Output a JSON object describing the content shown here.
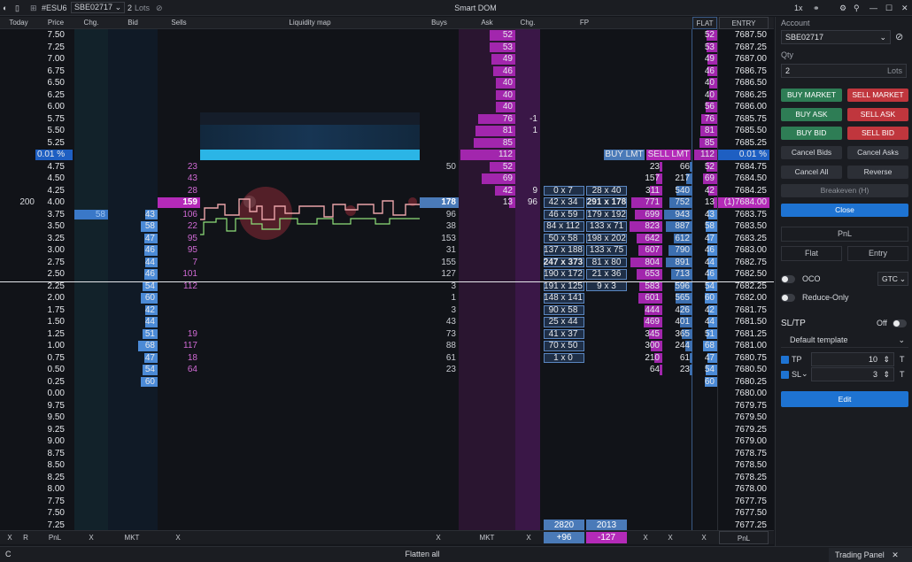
{
  "titlebar": {
    "symbol": "#ESU6",
    "account": "SBE02717",
    "lots_count": "2",
    "lots_unit": "Lots",
    "title": "Smart DOM",
    "zoom": "1x"
  },
  "headers": {
    "today": "Today",
    "price": "Price",
    "chg": "Chg.",
    "bid": "Bid",
    "sells": "Sells",
    "liq": "Liquidity map",
    "buys": "Buys",
    "ask": "Ask",
    "chg2": "Chg.",
    "fp": "FP",
    "flat": "FLAT",
    "entry": "ENTRY"
  },
  "rows": [
    {
      "price": "7.50",
      "ask": "52",
      "flat": "52",
      "entry": "7687.50"
    },
    {
      "price": "7.25",
      "ask": "53",
      "flat": "53",
      "entry": "7687.25"
    },
    {
      "price": "7.00",
      "ask": "49",
      "flat": "49",
      "entry": "7687.00"
    },
    {
      "price": "6.75",
      "ask": "46",
      "flat": "46",
      "entry": "7686.75"
    },
    {
      "price": "6.50",
      "ask": "40",
      "flat": "40",
      "entry": "7686.50"
    },
    {
      "price": "6.25",
      "ask": "40",
      "flat": "40",
      "entry": "7686.25"
    },
    {
      "price": "6.00",
      "ask": "40",
      "flat": "56",
      "entry": "7686.00"
    },
    {
      "price": "5.75",
      "ask": "76",
      "chg2": "-1",
      "flat": "76",
      "entry": "7685.75"
    },
    {
      "price": "5.50",
      "ask": "81",
      "chg2": "1",
      "flat": "81",
      "entry": "7685.50"
    },
    {
      "price": "5.25",
      "ask": "85",
      "flat": "85",
      "entry": "7685.25"
    },
    {
      "price": "0.01 %",
      "ask": "112",
      "fpl": "BUY LMT",
      "fpr": "SELL LMT",
      "flat": "112",
      "entry": "0.01 %"
    },
    {
      "price": "4.75",
      "sells": "23",
      "buys": "50",
      "ask": "52",
      "v1": "23",
      "v2": "66",
      "flat": "52",
      "entry": "7684.75"
    },
    {
      "price": "4.50",
      "sells": "43",
      "ask": "69",
      "v1": "157",
      "v2": "217",
      "flat": "69",
      "entry": "7684.50"
    },
    {
      "price": "4.25",
      "sells": "28",
      "ask": "42",
      "chg2": "9",
      "fpl": "0 x 7",
      "fpr": "28 x 40",
      "v1": "311",
      "v2": "540",
      "flat": "42",
      "entry": "7684.25"
    },
    {
      "today": "200",
      "price": "4.00",
      "sells": "159",
      "buys": "178",
      "ask": "13",
      "chg2": "96",
      "fpl": "42 x 34",
      "fpr": "291 x 178",
      "v1": "771",
      "v2": "752",
      "flat": "13",
      "entry": "(1)7684.00"
    },
    {
      "price": "3.75",
      "chg": "58",
      "bid": "43",
      "sells": "106",
      "buys": "96",
      "fpl": "46 x 59",
      "fpr": "179 x 192",
      "v1": "699",
      "v2": "943",
      "flat": "43",
      "entry": "7683.75"
    },
    {
      "price": "3.50",
      "bid": "58",
      "sells": "22",
      "buys": "38",
      "fpl": "84 x 112",
      "fpr": "133 x 71",
      "v1": "823",
      "v2": "887",
      "flat": "58",
      "entry": "7683.50"
    },
    {
      "price": "3.25",
      "bid": "47",
      "sells": "95",
      "buys": "153",
      "fpl": "50 x 58",
      "fpr": "198 x 202",
      "v1": "642",
      "v2": "612",
      "flat": "47",
      "entry": "7683.25"
    },
    {
      "price": "3.00",
      "bid": "46",
      "sells": "95",
      "buys": "31",
      "fpl": "137 x 188",
      "fpr": "133 x 75",
      "v1": "607",
      "v2": "790",
      "flat": "46",
      "entry": "7683.00"
    },
    {
      "price": "2.75",
      "bid": "44",
      "sells": "7",
      "buys": "155",
      "fpl": "247 x 373",
      "fpr": "81 x 80",
      "v1": "804",
      "v2": "891",
      "flat": "44",
      "entry": "7682.75"
    },
    {
      "price": "2.50",
      "bid": "46",
      "sells": "101",
      "buys": "127",
      "fpl": "190 x 172",
      "fpr": "21 x 36",
      "v1": "653",
      "v2": "713",
      "flat": "46",
      "entry": "7682.50"
    },
    {
      "price": "2.25",
      "bid": "54",
      "sells": "112",
      "buys": "3",
      "fpl": "191 x 125",
      "fpr": "9 x 3",
      "v1": "583",
      "v2": "596",
      "flat": "54",
      "entry": "7682.25"
    },
    {
      "price": "2.00",
      "bid": "60",
      "buys": "1",
      "fpl": "148 x 141",
      "v1": "601",
      "v2": "565",
      "flat": "60",
      "entry": "7682.00"
    },
    {
      "price": "1.75",
      "bid": "42",
      "buys": "3",
      "fpl": "90 x 58",
      "v1": "444",
      "v2": "426",
      "flat": "42",
      "entry": "7681.75"
    },
    {
      "price": "1.50",
      "bid": "44",
      "buys": "43",
      "fpl": "25 x 44",
      "v1": "469",
      "v2": "401",
      "flat": "44",
      "entry": "7681.50"
    },
    {
      "price": "1.25",
      "bid": "51",
      "sells": "19",
      "buys": "73",
      "fpl": "41 x 37",
      "v1": "345",
      "v2": "365",
      "flat": "51",
      "entry": "7681.25"
    },
    {
      "price": "1.00",
      "bid": "68",
      "sells": "117",
      "buys": "88",
      "fpl": "70 x 50",
      "v1": "300",
      "v2": "244",
      "flat": "68",
      "entry": "7681.00"
    },
    {
      "price": "0.75",
      "bid": "47",
      "sells": "18",
      "buys": "61",
      "fpl": "1 x 0",
      "v1": "210",
      "v2": "61",
      "flat": "47",
      "entry": "7680.75"
    },
    {
      "price": "0.50",
      "bid": "54",
      "sells": "64",
      "buys": "23",
      "v1": "64",
      "v2": "23",
      "flat": "54",
      "entry": "7680.50"
    },
    {
      "price": "0.25",
      "bid": "60",
      "flat": "60",
      "entry": "7680.25"
    },
    {
      "price": "0.00",
      "entry": "7680.00"
    },
    {
      "price": "9.75",
      "entry": "7679.75"
    },
    {
      "price": "9.50",
      "entry": "7679.50"
    },
    {
      "price": "9.25",
      "entry": "7679.25"
    },
    {
      "price": "9.00",
      "entry": "7679.00"
    },
    {
      "price": "8.75",
      "entry": "7678.75"
    },
    {
      "price": "8.50",
      "entry": "7678.50"
    },
    {
      "price": "8.25",
      "entry": "7678.25"
    },
    {
      "price": "8.00",
      "entry": "7678.00"
    },
    {
      "price": "7.75",
      "entry": "7677.75"
    },
    {
      "price": "7.50",
      "entry": "7677.50"
    },
    {
      "price": "7.25",
      "entry": "7677.25"
    }
  ],
  "fp_totals": {
    "left_top": "2820",
    "right_top": "2013",
    "left_bottom": "+96",
    "right_bottom": "-127"
  },
  "footer": {
    "x1": "X",
    "r": "R",
    "pnl": "PnL",
    "x2": "X",
    "mkt": "MKT",
    "x3": "X",
    "x4": "X",
    "mkt2": "MKT",
    "x5": "X",
    "x6": "X",
    "x7": "X",
    "x8": "X",
    "x9": "X",
    "pnl2": "PnL"
  },
  "status": {
    "left": "C",
    "flatten": "Flatten all",
    "panel_tab": "Trading Panel"
  },
  "panel": {
    "account_label": "Account",
    "account_value": "SBE02717",
    "qty_label": "Qty",
    "qty_value": "2",
    "qty_unit": "Lots",
    "buy_market": "BUY MARKET",
    "sell_market": "SELL MARKET",
    "buy_ask": "BUY ASK",
    "sell_ask": "SELL ASK",
    "buy_bid": "BUY BID",
    "sell_bid": "SELL BID",
    "cancel_bids": "Cancel Bids",
    "cancel_asks": "Cancel Asks",
    "cancel_all": "Cancel All",
    "reverse": "Reverse",
    "breakeven": "Breakeven (H)",
    "close": "Close",
    "pnl": "PnL",
    "flat": "Flat",
    "entry": "Entry",
    "oco": "OCO",
    "tif": "GTC",
    "reduce_only": "Reduce-Only",
    "sltp": "SL/TP",
    "sltp_state": "Off",
    "template": "Default template",
    "tp_label": "TP",
    "tp_value": "10",
    "tp_unit": "T",
    "sl_label": "SL",
    "sl_value": "3",
    "sl_unit": "T",
    "edit": "Edit"
  },
  "colors": {
    "buy": "#2e7d55",
    "sell": "#c0363d",
    "accent": "#1e73d2",
    "ask": "#b42ab8",
    "bid": "#4b8ad6"
  }
}
